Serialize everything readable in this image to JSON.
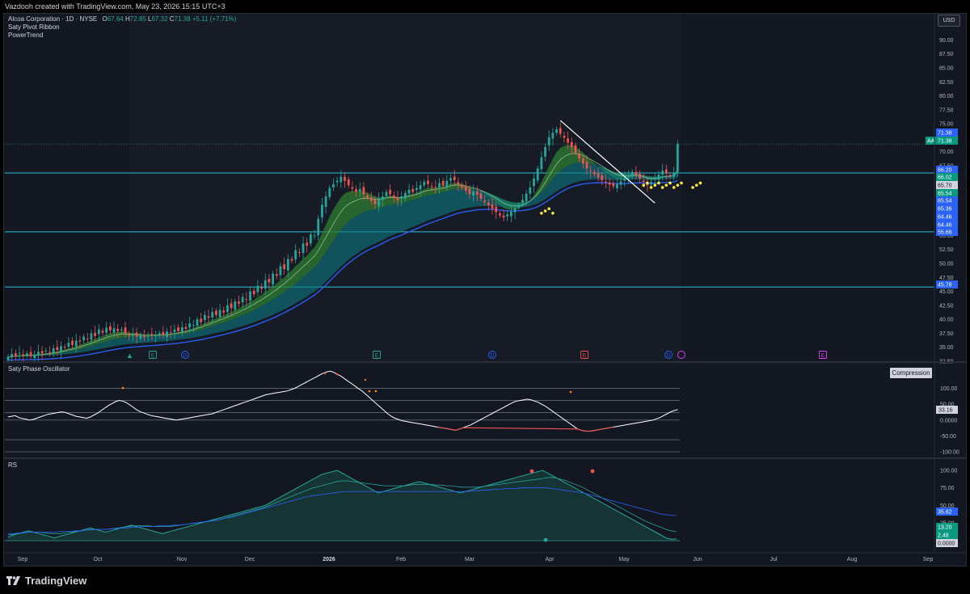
{
  "header": {
    "credit": "Vazdooh created with TradingView.com, May 23, 2026 15:15 UTC+3"
  },
  "legend": {
    "symbol_line": "Alcoa Corporation · 1D · NYSE",
    "open_label": "O",
    "open": "67.64",
    "high_label": "H",
    "high": "72.85",
    "low_label": "L",
    "low": "67.32",
    "close_label": "C",
    "close": "71.38",
    "change": "+5.11 (+7.71%)",
    "indicators": [
      "Saty Pivot Ribbon",
      "PowerTrend"
    ]
  },
  "currency": "USD",
  "panes": {
    "oscillator_title": "Saty Phase Oscillator",
    "oscillator_badge": "Compression",
    "rs_title": "RS"
  },
  "footer": {
    "brand": "TradingView"
  },
  "colors": {
    "background": "#131722",
    "up": "#26a69a",
    "down": "#ef5350",
    "level": "#26c6da",
    "ema": "#2962ff",
    "ribbon_green": "#2e7d32",
    "ribbon_teal": "#0e7a80",
    "signal": "#ffeb3b"
  },
  "chart_data": [
    {
      "type": "candlestick",
      "title": "Alcoa Corporation · 1D · NYSE",
      "x_tick_labels": [
        "Sep",
        "Oct",
        "Nov",
        "Dec",
        "2026",
        "Feb",
        "Mar",
        "Apr",
        "May",
        "Jun",
        "Jul",
        "Aug",
        "Sep"
      ],
      "y_tick_labels": [
        "90.00",
        "87.50",
        "85.00",
        "82.50",
        "80.00",
        "77.50",
        "75.00",
        "72.50",
        "70.00",
        "67.50",
        "65.00",
        "62.50",
        "60.00",
        "57.50",
        "55.00",
        "52.50",
        "50.00",
        "47.50",
        "45.00",
        "42.50",
        "40.00",
        "37.50",
        "35.00",
        "32.50"
      ],
      "ylim": [
        32.5,
        90.5
      ],
      "horizontal_levels": [
        66.2,
        55.66,
        45.78
      ],
      "price_labels": [
        {
          "value": "71.38",
          "color": "#2962ff"
        },
        {
          "value": "71.38",
          "color": "#089981",
          "tag": "AA"
        },
        {
          "value": "66.20",
          "color": "#2962ff"
        },
        {
          "value": "66.02",
          "color": "#089981"
        },
        {
          "value": "65.70",
          "color": "#d1d4dc"
        },
        {
          "value": "65.54",
          "color": "#089981"
        },
        {
          "value": "65.54",
          "color": "#2962ff"
        },
        {
          "value": "65.36",
          "color": "#2962ff"
        },
        {
          "value": "64.46",
          "color": "#2962ff"
        },
        {
          "value": "64.46",
          "color": "#2962ff"
        },
        {
          "value": "55.66",
          "color": "#2962ff"
        },
        {
          "value": "45.78",
          "color": "#2962ff"
        }
      ],
      "event_markers": [
        "E",
        "D",
        "E",
        "D",
        "E",
        "D",
        "E"
      ],
      "series": [
        {
          "close": [
            33.3,
            33.8,
            33.5,
            34.0,
            33.6,
            33.9,
            33.4,
            33.7,
            34.2,
            33.9,
            34.4,
            34.1,
            34.8,
            34.5,
            35.2,
            35.0,
            35.8,
            35.4,
            36.2,
            36.0,
            36.9,
            36.5,
            37.5,
            37.0,
            38.2,
            37.6,
            38.5,
            38.0,
            38.4,
            37.9,
            38.2,
            37.5,
            37.1,
            37.4,
            36.9,
            37.2,
            36.8,
            37.0,
            37.3,
            37.1,
            37.5,
            37.2,
            37.8,
            37.6,
            38.2,
            37.9,
            38.6,
            38.3,
            39.3,
            39.0,
            40.0,
            39.5,
            40.8,
            40.3,
            41.3,
            40.8,
            41.7,
            41.2,
            42.5,
            42.0,
            43.2,
            42.8,
            44.0,
            43.5,
            45.0,
            44.5,
            46.0,
            45.5,
            47.0,
            46.6,
            48.2,
            47.8,
            49.5,
            49.0,
            50.8,
            50.5,
            52.4,
            52.0,
            53.6,
            53.2,
            55.2,
            55.0,
            58.0,
            60.5,
            62.0,
            63.5,
            64.2,
            64.8,
            65.5,
            64.8,
            64.0,
            63.4,
            62.8,
            63.3,
            62.4,
            61.8,
            61.2,
            60.6,
            61.5,
            62.0,
            62.8,
            62.4,
            61.8,
            61.3,
            62.0,
            62.6,
            63.2,
            62.8,
            63.5,
            64.0,
            64.6,
            64.2,
            63.8,
            63.5,
            64.4,
            63.9,
            64.8,
            65.3,
            64.9,
            64.2,
            63.6,
            63.0,
            62.4,
            62.9,
            62.3,
            61.6,
            61.0,
            60.4,
            59.8,
            59.2,
            58.6,
            58.2,
            58.8,
            59.3,
            59.9,
            60.5,
            61.4,
            62.5,
            63.6,
            65.2,
            67.0,
            69.0,
            70.8,
            72.6,
            73.4,
            74.0,
            73.2,
            72.5,
            71.6,
            70.8,
            69.8,
            68.8,
            67.9,
            67.0,
            66.5,
            66.0,
            65.4,
            64.9,
            64.5,
            64.1,
            63.8,
            64.2,
            64.7,
            65.2,
            65.8,
            66.4,
            65.8,
            65.2,
            64.6,
            64.0,
            64.6,
            65.2,
            65.9,
            66.6,
            66.2,
            65.7,
            66.3,
            71.38
          ]
        },
        {
          "name": "PowerTrend",
          "color": "#2962ff"
        }
      ]
    },
    {
      "type": "line",
      "title": "Saty Phase Oscillator",
      "y_tick_labels": [
        "100.00",
        "50.00",
        "0.0000",
        "-50.00",
        "-100.00"
      ],
      "ylim": [
        -115,
        165
      ],
      "current_value": "33.16",
      "levels": [
        100,
        61.8,
        23.6,
        0,
        -61.8,
        -100
      ],
      "series": [
        {
          "values": [
            10,
            12,
            14,
            8,
            5,
            3,
            0,
            2,
            6,
            10,
            14,
            18,
            20,
            22,
            24,
            26,
            24,
            20,
            16,
            12,
            10,
            8,
            6,
            10,
            16,
            22,
            30,
            38,
            46,
            52,
            58,
            62,
            60,
            55,
            48,
            40,
            32,
            26,
            22,
            18,
            14,
            12,
            10,
            8,
            6,
            4,
            2,
            0,
            2,
            4,
            6,
            8,
            10,
            12,
            14,
            16,
            18,
            20,
            24,
            28,
            32,
            36,
            40,
            44,
            48,
            52,
            56,
            60,
            64,
            68,
            72,
            76,
            80,
            82,
            84,
            86,
            88,
            90,
            92,
            96,
            100,
            106,
            112,
            118,
            124,
            130,
            136,
            142,
            148,
            152,
            154,
            150,
            144,
            138,
            130,
            122,
            114,
            106,
            98,
            90,
            80,
            70,
            60,
            50,
            40,
            30,
            20,
            12,
            6,
            2,
            -2,
            -4,
            -6,
            -8,
            -10,
            -12,
            -14,
            -16,
            -18,
            -20,
            -22,
            -24,
            -26,
            -28,
            -30,
            -32,
            -28,
            -24,
            -20,
            -16,
            -10,
            -4,
            2,
            8,
            14,
            20,
            26,
            32,
            38,
            44,
            50,
            56,
            60,
            62,
            64,
            66,
            64,
            60,
            56,
            50,
            44,
            36,
            28,
            20,
            12,
            4,
            -4,
            -12,
            -20,
            -28,
            -32,
            -34,
            -35,
            -34,
            -32,
            -30,
            -28,
            -26,
            -24,
            -22,
            -20,
            -18,
            -16,
            -14,
            -12,
            -10,
            -8,
            -6,
            -4,
            -2,
            0,
            4,
            8,
            14,
            20,
            26,
            30,
            33.16
          ]
        }
      ]
    },
    {
      "type": "line",
      "title": "RS",
      "y_tick_labels": [
        "100.00",
        "75.00",
        "50.00",
        "25.00",
        "0.0000"
      ],
      "ylim": [
        -15,
        108
      ],
      "current_values": [
        "35.82",
        "13.20",
        "2.48"
      ],
      "series": [
        {
          "values": [
            5,
            8,
            10,
            12,
            14,
            12,
            10,
            8,
            6,
            4,
            6,
            8,
            10,
            12,
            14,
            16,
            18,
            16,
            14,
            12,
            14,
            16,
            18,
            20,
            22,
            20,
            18,
            16,
            14,
            12,
            10,
            12,
            14,
            16,
            18,
            20,
            22,
            24,
            26,
            28,
            30,
            32,
            34,
            36,
            38,
            40,
            42,
            44,
            46,
            48,
            50,
            54,
            58,
            62,
            66,
            70,
            74,
            78,
            82,
            86,
            90,
            94,
            96,
            98,
            100,
            96,
            92,
            88,
            84,
            80,
            76,
            72,
            68,
            70,
            72,
            74,
            76,
            78,
            80,
            82,
            84,
            82,
            80,
            78,
            76,
            74,
            72,
            70,
            68,
            70,
            72,
            74,
            76,
            78,
            80,
            82,
            84,
            86,
            88,
            90,
            92,
            94,
            96,
            98,
            100,
            96,
            92,
            88,
            84,
            80,
            76,
            72,
            68,
            64,
            60,
            56,
            52,
            48,
            44,
            40,
            36,
            32,
            28,
            24,
            20,
            16,
            12,
            8,
            4,
            2,
            2.48
          ]
        },
        {
          "values": [
            8,
            9,
            10,
            11,
            12,
            12,
            12,
            11,
            10,
            10,
            10,
            11,
            12,
            13,
            14,
            15,
            16,
            16,
            16,
            16,
            17,
            18,
            19,
            20,
            21,
            21,
            21,
            21,
            20,
            20,
            20,
            20,
            21,
            22,
            23,
            24,
            25,
            26,
            27,
            28,
            29,
            31,
            33,
            35,
            37,
            39,
            41,
            43,
            45,
            47,
            50,
            53,
            56,
            59,
            62,
            65,
            68,
            71,
            74,
            76,
            78,
            80,
            82,
            84,
            85,
            85,
            84,
            83,
            82,
            81,
            80,
            79,
            78,
            78,
            78,
            78,
            78,
            79,
            80,
            80,
            80,
            80,
            79,
            79,
            78,
            78,
            77,
            76,
            76,
            76,
            76,
            77,
            78,
            79,
            80,
            81,
            82,
            83,
            84,
            85,
            86,
            87,
            88,
            89,
            90,
            89,
            87,
            85,
            82,
            79,
            76,
            72,
            68,
            64,
            60,
            56,
            52,
            48,
            44,
            40,
            36,
            32,
            28,
            25,
            22,
            19,
            16,
            14,
            13.2
          ]
        },
        {
          "values": [
            10,
            10,
            11,
            11,
            12,
            12,
            12,
            12,
            12,
            12,
            13,
            13,
            13,
            14,
            14,
            15,
            15,
            16,
            16,
            16,
            17,
            17,
            18,
            18,
            19,
            19,
            20,
            20,
            20,
            21,
            21,
            21,
            22,
            22,
            23,
            24,
            25,
            26,
            27,
            28,
            29,
            30,
            32,
            33,
            35,
            37,
            39,
            41,
            43,
            45,
            47,
            49,
            51,
            53,
            55,
            57,
            59,
            61,
            63,
            64,
            65,
            66,
            67,
            68,
            69,
            70,
            70,
            70,
            70,
            70,
            70,
            70,
            70,
            70,
            70,
            70,
            70,
            70,
            70,
            70,
            70,
            70,
            70,
            70,
            70,
            70,
            70,
            70,
            70,
            70,
            71,
            71,
            72,
            72,
            73,
            73,
            74,
            74,
            74,
            75,
            75,
            75,
            75,
            75,
            75,
            74,
            73,
            72,
            71,
            70,
            69,
            68,
            66,
            64,
            62,
            60,
            58,
            56,
            54,
            52,
            50,
            48,
            46,
            44,
            42,
            40,
            38,
            37,
            36,
            35.82
          ]
        }
      ]
    }
  ]
}
